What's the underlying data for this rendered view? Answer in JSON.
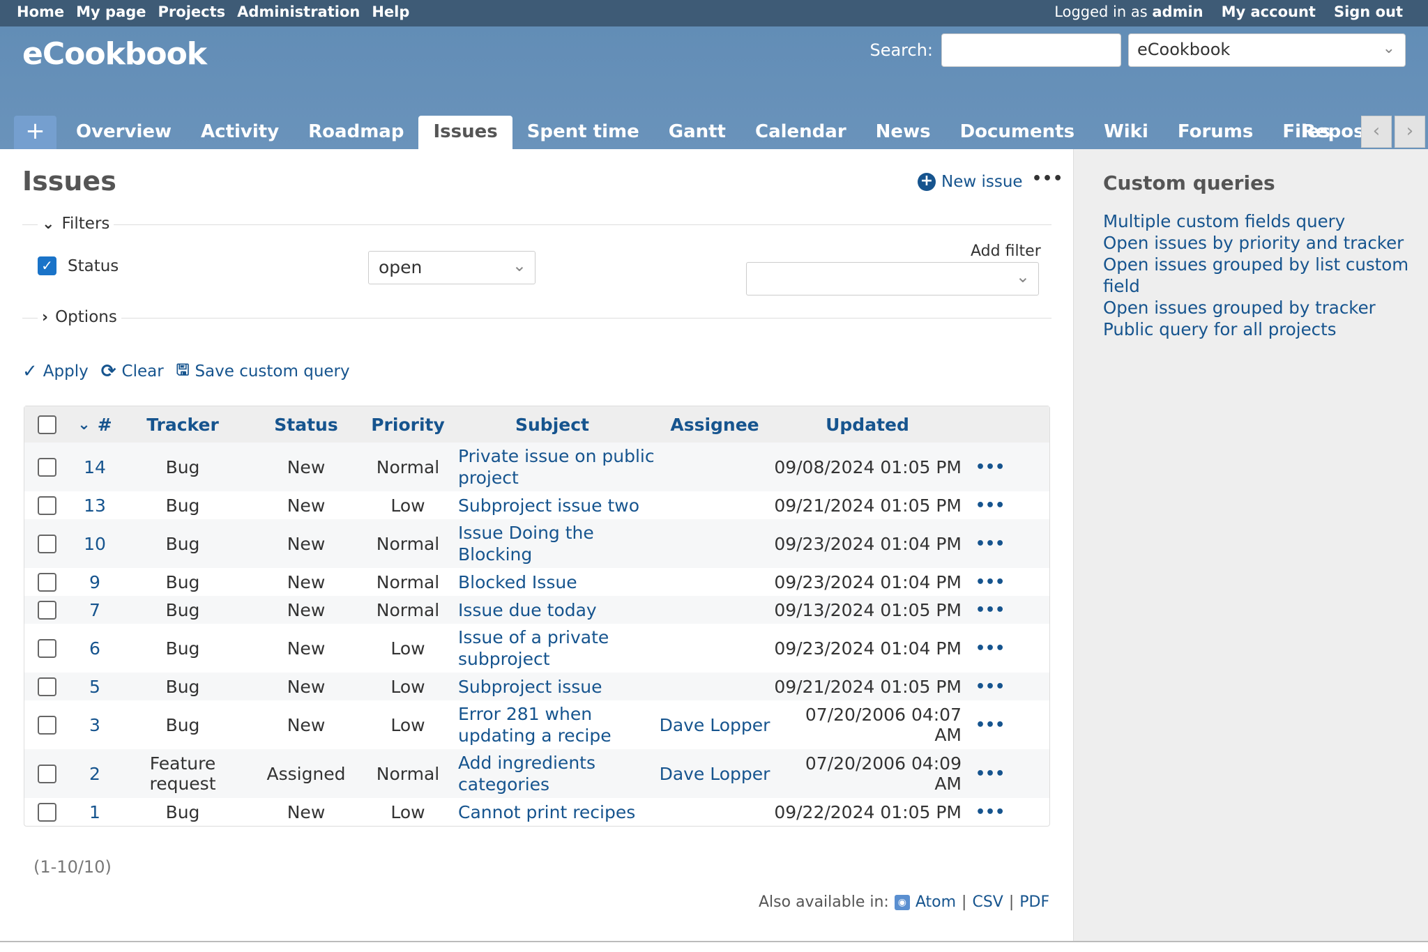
{
  "top_menu": {
    "left": [
      "Home",
      "My page",
      "Projects",
      "Administration",
      "Help"
    ],
    "logged_in_prefix": "Logged in as",
    "logged_in_user": "admin",
    "my_account": "My account",
    "sign_out": "Sign out"
  },
  "header": {
    "title": "eCookbook",
    "search_label": "Search:",
    "search_value": "",
    "project_select": "eCookbook"
  },
  "tabs": {
    "plus": "+",
    "items": [
      "Overview",
      "Activity",
      "Roadmap",
      "Issues",
      "Spent time",
      "Gantt",
      "Calendar",
      "News",
      "Documents",
      "Wiki",
      "Forums",
      "Files"
    ],
    "selected": "Issues",
    "clipped": "Repository"
  },
  "content": {
    "title": "Issues",
    "new_issue": "New issue",
    "filters_legend": "Filters",
    "status_label": "Status",
    "status_value": "open",
    "add_filter_label": "Add filter",
    "add_filter_value": "",
    "options_legend": "Options",
    "apply": "Apply",
    "clear": "Clear",
    "save_query": "Save custom query"
  },
  "table": {
    "headers": {
      "id": "#",
      "tracker": "Tracker",
      "status": "Status",
      "priority": "Priority",
      "subject": "Subject",
      "assignee": "Assignee",
      "updated": "Updated"
    },
    "rows": [
      {
        "id": "14",
        "tracker": "Bug",
        "status": "New",
        "priority": "Normal",
        "subject": "Private issue on public project",
        "assignee": "",
        "updated": "09/08/2024 01:05 PM"
      },
      {
        "id": "13",
        "tracker": "Bug",
        "status": "New",
        "priority": "Low",
        "subject": "Subproject issue two",
        "assignee": "",
        "updated": "09/21/2024 01:05 PM"
      },
      {
        "id": "10",
        "tracker": "Bug",
        "status": "New",
        "priority": "Normal",
        "subject": "Issue Doing the Blocking",
        "assignee": "",
        "updated": "09/23/2024 01:04 PM"
      },
      {
        "id": "9",
        "tracker": "Bug",
        "status": "New",
        "priority": "Normal",
        "subject": "Blocked Issue",
        "assignee": "",
        "updated": "09/23/2024 01:04 PM"
      },
      {
        "id": "7",
        "tracker": "Bug",
        "status": "New",
        "priority": "Normal",
        "subject": "Issue due today",
        "assignee": "",
        "updated": "09/13/2024 01:05 PM"
      },
      {
        "id": "6",
        "tracker": "Bug",
        "status": "New",
        "priority": "Low",
        "subject": "Issue of a private subproject",
        "assignee": "",
        "updated": "09/23/2024 01:04 PM"
      },
      {
        "id": "5",
        "tracker": "Bug",
        "status": "New",
        "priority": "Low",
        "subject": "Subproject issue",
        "assignee": "",
        "updated": "09/21/2024 01:05 PM"
      },
      {
        "id": "3",
        "tracker": "Bug",
        "status": "New",
        "priority": "Low",
        "subject": "Error 281 when updating a recipe",
        "assignee": "Dave Lopper",
        "updated": "07/20/2006 04:07 AM"
      },
      {
        "id": "2",
        "tracker": "Feature request",
        "status": "Assigned",
        "priority": "Normal",
        "subject": "Add ingredients categories",
        "assignee": "Dave Lopper",
        "updated": "07/20/2006 04:09 AM"
      },
      {
        "id": "1",
        "tracker": "Bug",
        "status": "New",
        "priority": "Low",
        "subject": "Cannot print recipes",
        "assignee": "",
        "updated": "09/22/2024 01:05 PM"
      }
    ]
  },
  "pagination": "(1-10/10)",
  "formats": {
    "label": "Also available in:",
    "atom": "Atom",
    "csv": "CSV",
    "pdf": "PDF",
    "sep": "|"
  },
  "sidebar": {
    "title": "Custom queries",
    "queries": [
      "Multiple custom fields query",
      "Open issues by priority and tracker",
      "Open issues grouped by list custom field",
      "Open issues grouped by tracker",
      "Public query for all projects"
    ]
  }
}
